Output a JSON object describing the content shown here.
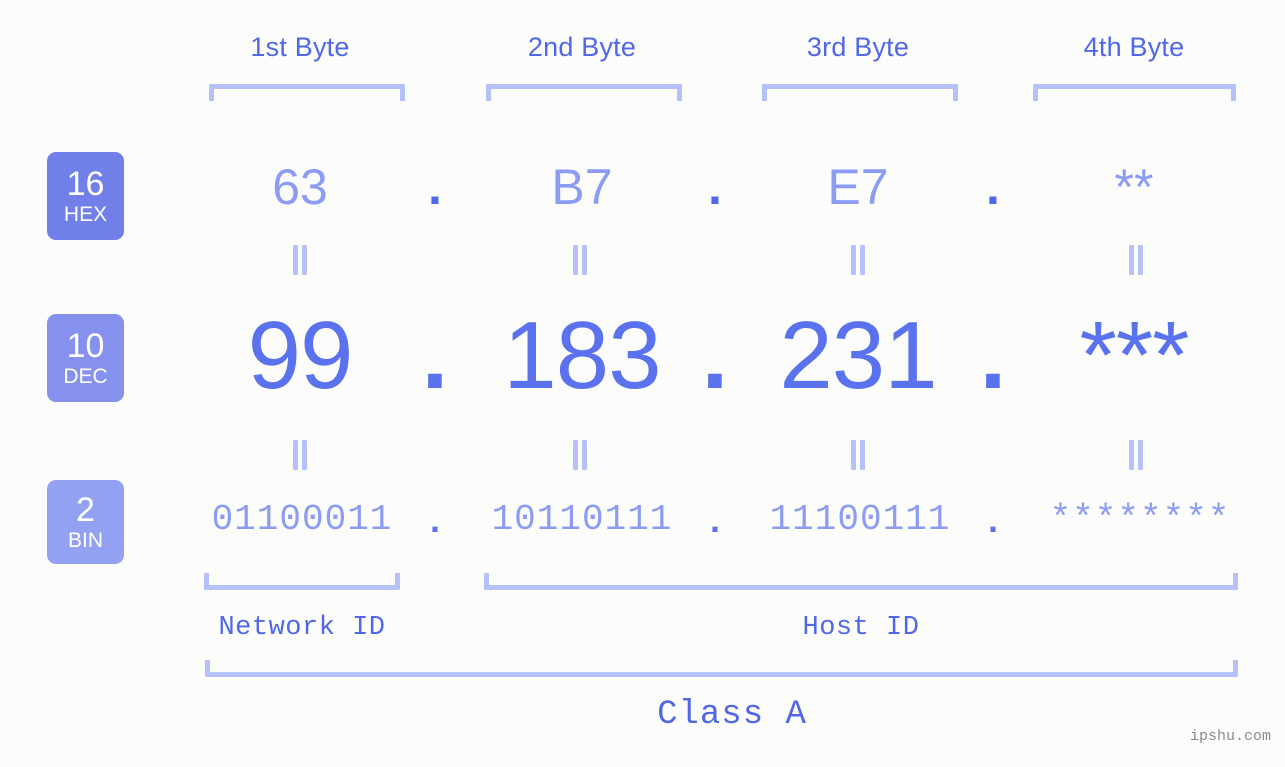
{
  "meta": {
    "watermark": "ipshu.com",
    "background_color": "#fcfdfa",
    "accent_dark": "#4f67e8",
    "accent_mid": "#5b72ee",
    "accent_light": "#8c9cf5",
    "accent_pale": "#b6c1fa"
  },
  "headers": [
    {
      "label": "1st Byte"
    },
    {
      "label": "2nd Byte"
    },
    {
      "label": "3rd Byte"
    },
    {
      "label": "4th Byte"
    }
  ],
  "bases": [
    {
      "id": "hex",
      "number": "16",
      "abbr": "HEX",
      "color": "#7180e8"
    },
    {
      "id": "dec",
      "number": "10",
      "abbr": "DEC",
      "color": "#8691ed"
    },
    {
      "id": "bin",
      "number": "2",
      "abbr": "BIN",
      "color": "#93a1f3"
    }
  ],
  "rows": {
    "hex": {
      "values": [
        "63",
        "B7",
        "E7",
        "**"
      ],
      "separator": "."
    },
    "dec": {
      "values": [
        "99",
        "183",
        "231",
        "***"
      ],
      "separator": "."
    },
    "bin": {
      "values": [
        "01100011",
        "10110111",
        "11100111",
        "********"
      ],
      "separator": "."
    }
  },
  "equals_symbol": "=",
  "sections": [
    {
      "id": "network-id",
      "label": "Network ID"
    },
    {
      "id": "host-id",
      "label": "Host ID"
    }
  ],
  "class": {
    "label": "Class A"
  }
}
